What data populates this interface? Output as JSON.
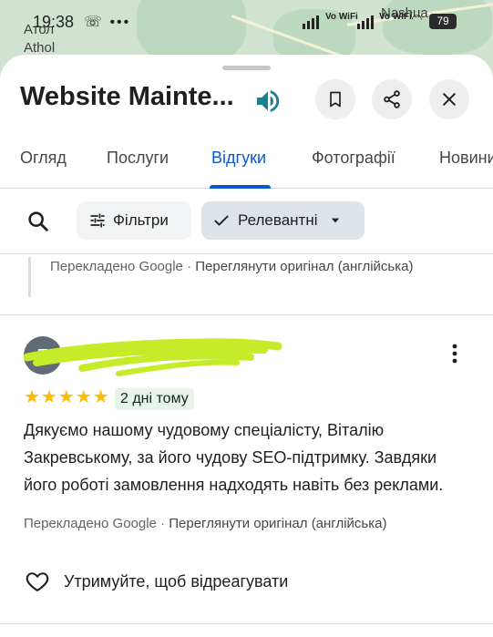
{
  "map": {
    "labels": [
      "Атол",
      "Athol",
      "Nashua"
    ]
  },
  "status_bar": {
    "time": "19:38",
    "battery": "79",
    "network_1": "Vo WiFi",
    "network_2": "Vo WiFi"
  },
  "place": {
    "title": "Website Mainte..."
  },
  "tabs": [
    {
      "label": "Огляд"
    },
    {
      "label": "Послуги"
    },
    {
      "label": "Відгуки"
    },
    {
      "label": "Фотографії"
    },
    {
      "label": "Новини"
    }
  ],
  "filters": {
    "filters_label": "Фільтри",
    "sort_label": "Релевантні"
  },
  "previous_review": {
    "translated_by": "Перекладено Google",
    "separator": " · ",
    "see_original": "Переглянути оригінал (англійська)"
  },
  "review": {
    "avatar_letter": "П",
    "rating": 5,
    "date": "2 дні тому",
    "text": "Дякуємо нашому чудовому спеціалісту, Віталію Закревському, за його чудову SEO-підтримку. Завдяки його роботі замовлення надходять навіть без реклами.",
    "translated_by": "Перекладено Google",
    "separator": " · ",
    "see_original": "Переглянути оригінал (англійська)",
    "react_label": "Утримуйте, щоб відреагувати"
  },
  "colors": {
    "accent": "#0b57d0",
    "star": "#fbbc04",
    "speaker": "#1a7f8e",
    "redaction": "#c6ec29"
  },
  "icons": [
    "speaker-icon",
    "bookmark-icon",
    "share-icon",
    "close-icon",
    "search-icon",
    "tune-icon",
    "check-icon",
    "dropdown-arrow-icon",
    "more-vert-icon",
    "heart-icon"
  ]
}
